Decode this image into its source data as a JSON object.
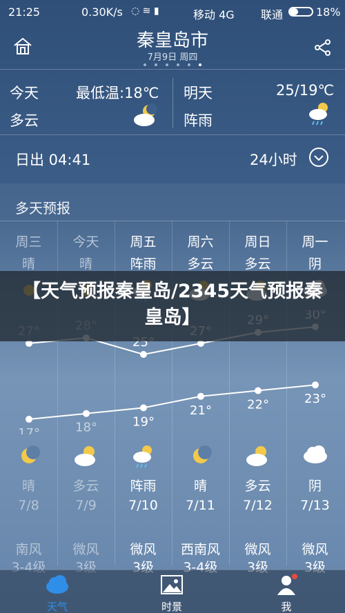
{
  "status_bar": {
    "time": "21:25",
    "speed": "0.30K/s",
    "carrier1": "移动 4G",
    "carrier2": "联通",
    "battery": "18%"
  },
  "header": {
    "city": "秦皇岛市",
    "date": "7月9日 周四"
  },
  "today": {
    "label": "今天",
    "low_temp": "最低温:18℃",
    "condition": "多云",
    "icon": "partly-cloudy-night-icon"
  },
  "tomorrow": {
    "label": "明天",
    "temp_range": "25/19℃",
    "condition": "阵雨",
    "icon": "shower-icon"
  },
  "sunrise": {
    "text": "日出 04:41",
    "hours_label": "24小时"
  },
  "forecast": {
    "title": "多天预报",
    "days": [
      {
        "weekday": "周三",
        "day_cond": "晴",
        "night_cond": "晴",
        "date": "7/8",
        "wind": "南风",
        "wind_level": "3-4级",
        "high": 27,
        "low": 17,
        "dim": true
      },
      {
        "weekday": "今天",
        "day_cond": "晴",
        "night_cond": "多云",
        "date": "7/9",
        "wind": "微风",
        "wind_level": "3级",
        "high": 28,
        "low": 18,
        "dim": true
      },
      {
        "weekday": "周五",
        "day_cond": "阵雨",
        "night_cond": "阵雨",
        "date": "7/10",
        "wind": "微风",
        "wind_level": "3级",
        "high": 25,
        "low": 19,
        "dim": false
      },
      {
        "weekday": "周六",
        "day_cond": "多云",
        "night_cond": "晴",
        "date": "7/11",
        "wind": "西南风",
        "wind_level": "3-4级",
        "high": 27,
        "low": 21,
        "dim": false
      },
      {
        "weekday": "周日",
        "day_cond": "多云",
        "night_cond": "多云",
        "date": "7/12",
        "wind": "微风",
        "wind_level": "3级",
        "high": 29,
        "low": 22,
        "dim": false
      },
      {
        "weekday": "周一",
        "day_cond": "阴",
        "night_cond": "阴",
        "date": "7/13",
        "wind": "微风",
        "wind_level": "3级",
        "high": 30,
        "low": 23,
        "dim": false
      }
    ]
  },
  "chart_data": {
    "type": "line",
    "categories": [
      "7/8",
      "7/9",
      "7/10",
      "7/11",
      "7/12",
      "7/13"
    ],
    "series": [
      {
        "values": [
          27,
          28,
          25,
          27,
          29,
          30
        ]
      },
      {
        "values": [
          17,
          18,
          19,
          21,
          22,
          23
        ]
      }
    ]
  },
  "banner": {
    "text": "【天气预报秦皇岛/2345天气预报秦皇岛】"
  },
  "tabs": [
    {
      "label": "天气",
      "icon": "cloud-icon",
      "active": true
    },
    {
      "label": "时景",
      "icon": "picture-icon",
      "active": false
    },
    {
      "label": "我",
      "icon": "user-icon",
      "active": false
    }
  ],
  "colors": {
    "active_tab": "#2f8fe8",
    "sun": "#f3c94a",
    "notification": "#e74c3c"
  }
}
